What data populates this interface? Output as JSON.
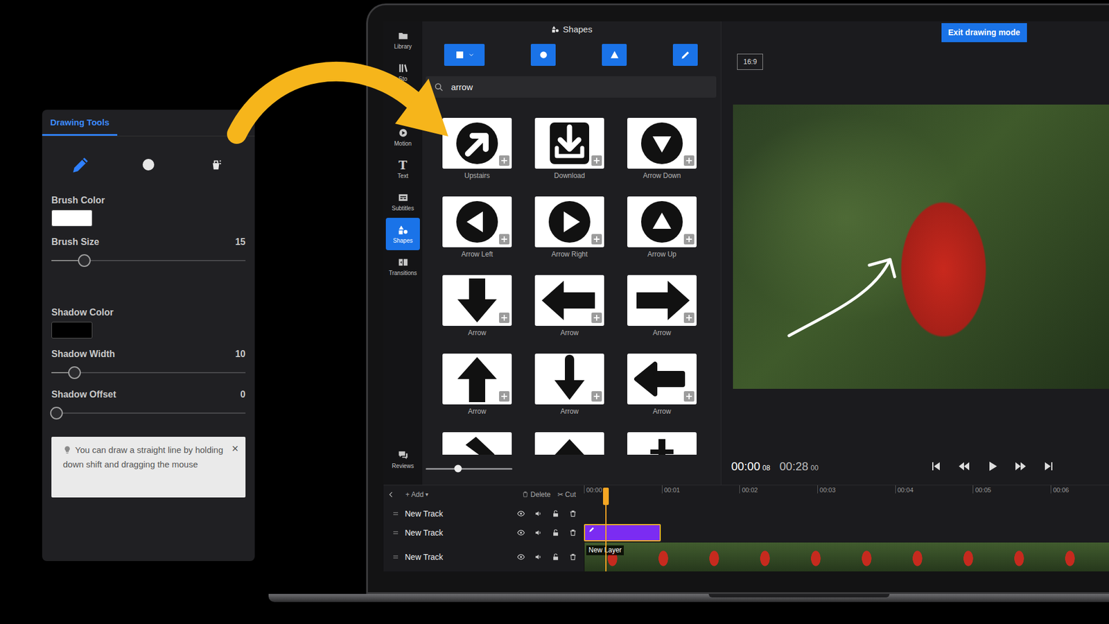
{
  "drawing_tools": {
    "tab": {
      "label": "Drawing Tools",
      "selected": true
    },
    "tools": [
      {
        "kind": "pencil",
        "selected": true
      },
      {
        "kind": "circle",
        "selected": false
      },
      {
        "kind": "bucket",
        "selected": false
      }
    ],
    "fields": [
      {
        "kind": "color",
        "label": "Brush Color",
        "swatch": "#ffffff"
      },
      {
        "kind": "slider",
        "label": "Brush Size",
        "reading": "15",
        "level": 0.17
      },
      {
        "kind": "color",
        "label": "Shadow Color",
        "swatch": "#000000"
      },
      {
        "kind": "slider",
        "label": "Shadow Width",
        "reading": "10",
        "level": 0.12
      },
      {
        "kind": "slider",
        "label": "Shadow Offset",
        "reading": "0",
        "level": 0
      }
    ],
    "tip": {
      "text": "You can draw a straight line by holding down shift and dragging the mouse",
      "close": "×"
    }
  },
  "sidebar": {
    "items": [
      {
        "label": "Library",
        "selected": false
      },
      {
        "label": "Sto",
        "selected": false
      },
      {
        "label": "Motion",
        "selected": false
      },
      {
        "label": "Text",
        "glyph": "T",
        "selected": false
      },
      {
        "label": "Subtitles",
        "selected": false
      },
      {
        "label": "Shapes",
        "selected": true
      },
      {
        "label": "Transitions",
        "selected": false
      }
    ],
    "bottom": {
      "label": "Reviews",
      "selected": false
    }
  },
  "shapes_panel": {
    "title": "Shapes",
    "search": {
      "value": "arrow"
    },
    "cards": [
      {
        "label": "Upstairs",
        "kind": "upstairs"
      },
      {
        "label": "Download",
        "kind": "download"
      },
      {
        "label": "Arrow Down",
        "kind": "circledown"
      },
      {
        "label": "Arrow Left",
        "kind": "circleleft"
      },
      {
        "label": "Arrow Right",
        "kind": "circleright"
      },
      {
        "label": "Arrow Up",
        "kind": "circleup"
      },
      {
        "label": "Arrow",
        "kind": "down"
      },
      {
        "label": "Arrow",
        "kind": "leftbold"
      },
      {
        "label": "Arrow",
        "kind": "rightbold"
      },
      {
        "label": "Arrow",
        "kind": "up"
      },
      {
        "label": "Arrow",
        "kind": "downthin"
      },
      {
        "label": "Arrow",
        "kind": "leftround"
      },
      {
        "kind": "slant"
      },
      {
        "kind": "peak"
      },
      {
        "kind": "stem"
      }
    ],
    "zoom": {
      "level": 0.37
    }
  },
  "preview": {
    "exit_button": "Exit drawing mode",
    "aspect": "16:9",
    "time": {
      "current": "00:00",
      "current_frames": "08",
      "total": "00:28",
      "total_frames": "00"
    }
  },
  "timeline": {
    "toolbar": {
      "add": {
        "icon": "+",
        "label": "Add",
        "caret": "▾"
      },
      "delete": {
        "label": "Delete"
      },
      "cut": {
        "icon": "✂",
        "label": "Cut"
      }
    },
    "ruler": [
      "00:00",
      "00:01",
      "00:02",
      "00:03",
      "00:04",
      "00:05",
      "00:06"
    ],
    "playhead": {
      "level": 0.042
    },
    "tracks": [
      {
        "name": "New Track",
        "kind": "empty"
      },
      {
        "name": "New Track",
        "kind": "drawing",
        "clip": {
          "label": "New Layer"
        }
      },
      {
        "name": "New Track",
        "kind": "video"
      }
    ]
  }
}
